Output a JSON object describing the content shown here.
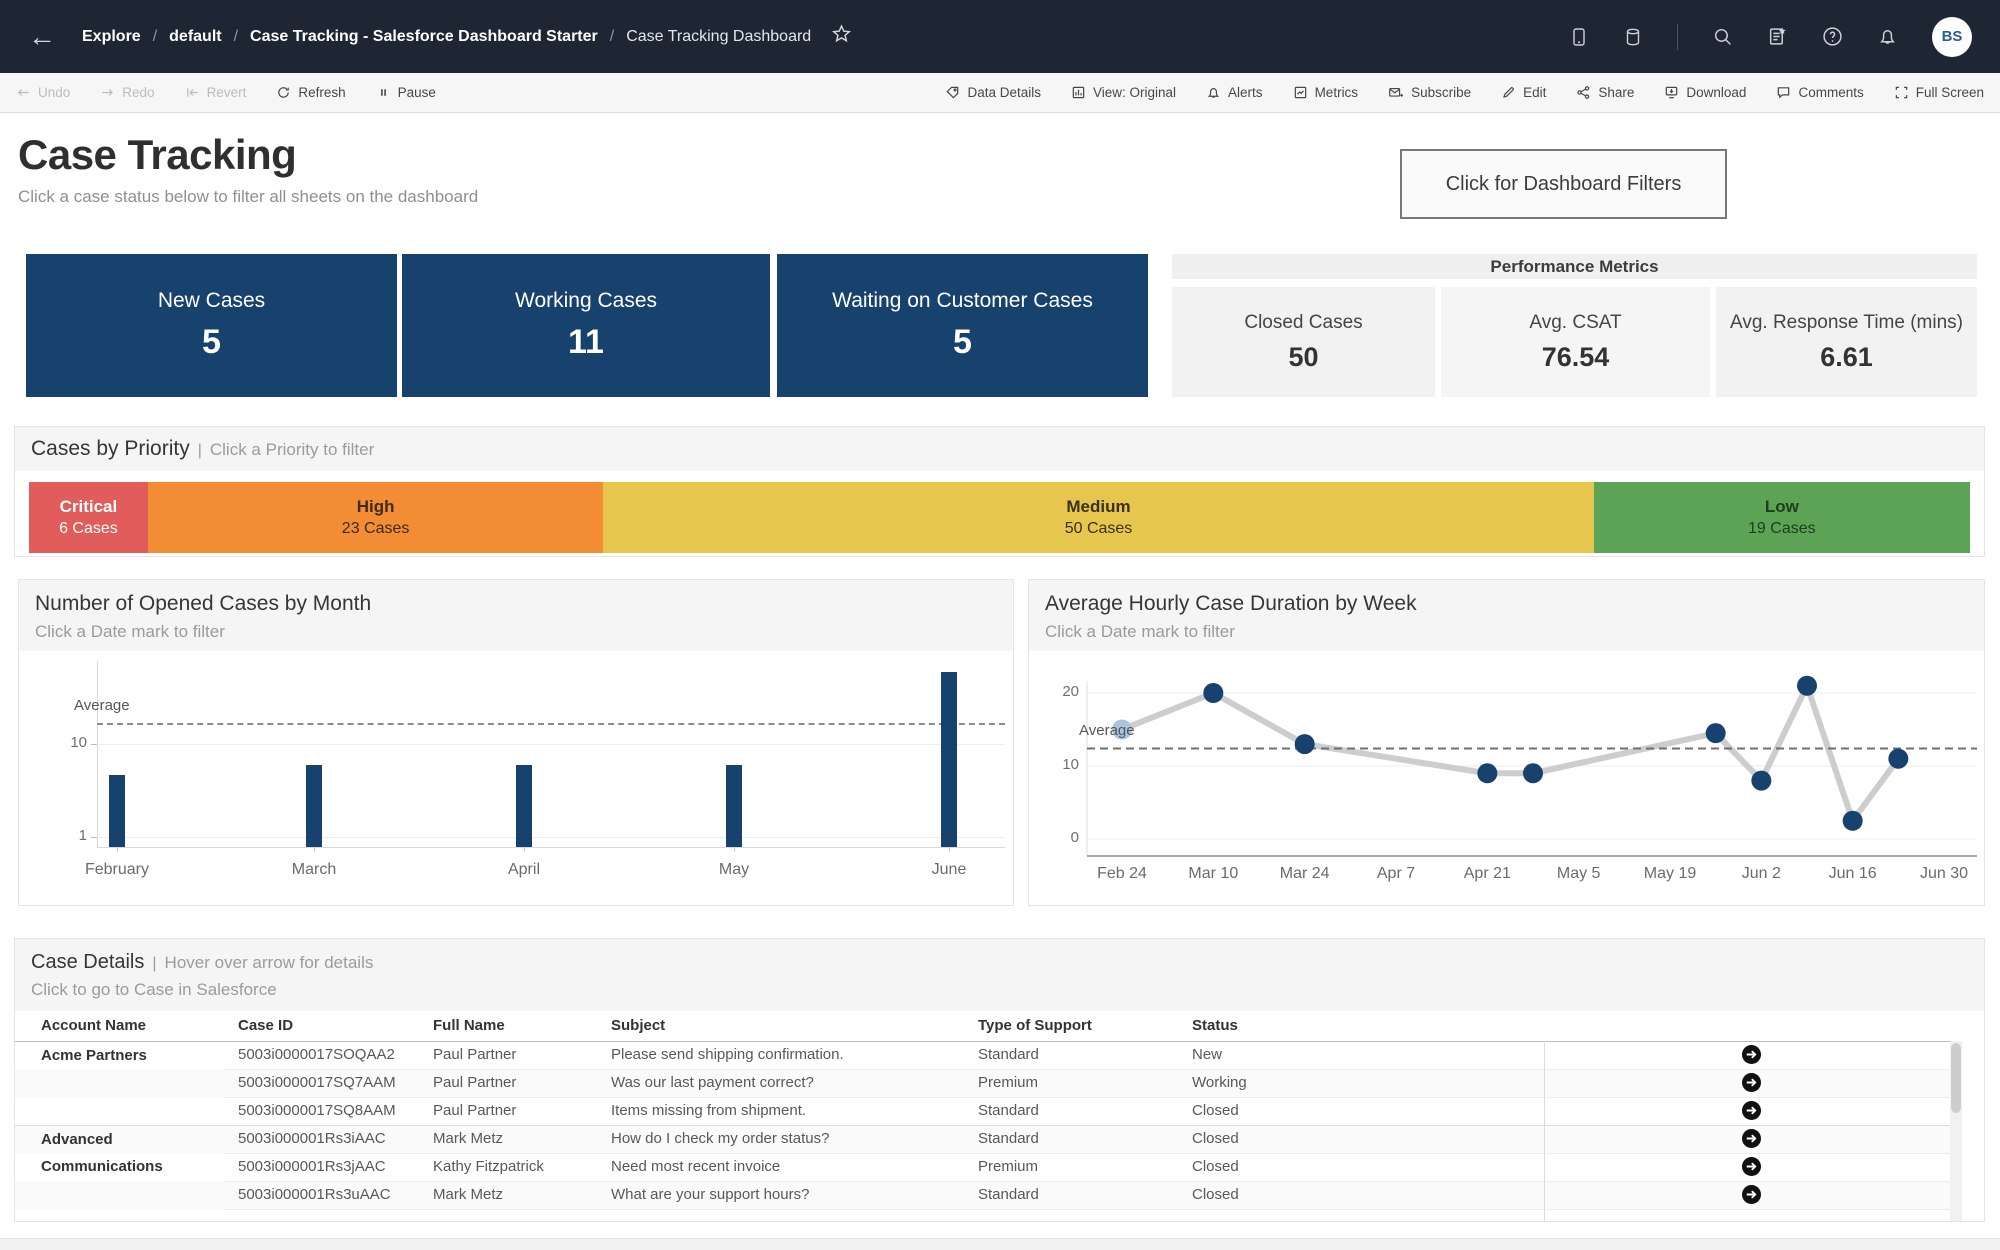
{
  "ui": {
    "pipe": "|"
  },
  "nav": {
    "back_icon": "←",
    "separator": "/",
    "breadcrumb": [
      {
        "label": "Explore"
      },
      {
        "label": "default"
      },
      {
        "label": "Case Tracking - Salesforce Dashboard Starter"
      },
      {
        "label": "Case Tracking Dashboard"
      }
    ],
    "avatar_initials": "BS"
  },
  "toolbar": {
    "left": [
      {
        "label": "Undo",
        "disabled": true
      },
      {
        "label": "Redo",
        "disabled": true
      },
      {
        "label": "Revert",
        "disabled": true
      },
      {
        "label": "Refresh",
        "disabled": false
      },
      {
        "label": "Pause",
        "disabled": false
      }
    ],
    "right": [
      {
        "label": "Data Details"
      },
      {
        "label": "View: Original"
      },
      {
        "label": "Alerts"
      },
      {
        "label": "Metrics"
      },
      {
        "label": "Subscribe"
      },
      {
        "label": "Edit"
      },
      {
        "label": "Share"
      },
      {
        "label": "Download"
      },
      {
        "label": "Comments"
      },
      {
        "label": "Full Screen"
      }
    ]
  },
  "header": {
    "title": "Case Tracking",
    "subtitle": "Click a case status below to filter all sheets on the dashboard",
    "filter_button": "Click for Dashboard Filters"
  },
  "kpis": [
    {
      "label": "New Cases",
      "value": "5",
      "color": "#17426e"
    },
    {
      "label": "Working Cases",
      "value": "11",
      "color": "#17426e"
    },
    {
      "label": "Waiting on Customer Cases",
      "value": "5",
      "color": "#17426e"
    }
  ],
  "performance": {
    "title": "Performance Metrics",
    "metrics": [
      {
        "label": "Closed Cases",
        "value": "50"
      },
      {
        "label": "Avg. CSAT",
        "value": "76.54"
      },
      {
        "label": "Avg. Response Time (mins)",
        "value": "6.61"
      }
    ]
  },
  "priority": {
    "title": "Cases by Priority",
    "hint": "Click a Priority to filter",
    "cases_word": "Cases",
    "segments": [
      {
        "key": "critical",
        "label": "Critical",
        "cases": 6,
        "color": "#e05d5c",
        "text_color": "#ffffff"
      },
      {
        "key": "high",
        "label": "High",
        "cases": 23,
        "color": "#f28d35",
        "text_color": "#3d2c12"
      },
      {
        "key": "medium",
        "label": "Medium",
        "cases": 50,
        "color": "#e7c64e",
        "text_color": "#3a3115"
      },
      {
        "key": "low",
        "label": "Low",
        "cases": 19,
        "color": "#5ca356",
        "text_color": "#1f3d1f"
      }
    ]
  },
  "chart_data": [
    {
      "type": "bar",
      "title": "Number of Opened Cases by Month",
      "subtitle": "Click a Date mark to filter",
      "categories": [
        "February",
        "March",
        "April",
        "May",
        "June"
      ],
      "values": [
        7,
        8,
        8,
        8,
        17
      ],
      "average_line": 12,
      "average_label": "Average",
      "yticks": [
        1,
        10
      ],
      "ylim": [
        0,
        18.5
      ],
      "xlabel": "",
      "ylabel": "",
      "grid": "horizontal-light",
      "legend": "none",
      "bar_color": "#17426e"
    },
    {
      "type": "line",
      "title": "Average Hourly Case Duration by Week",
      "subtitle": "Click a Date mark to filter",
      "x_tick_labels": [
        "Feb 24",
        "Mar 10",
        "Mar 24",
        "Apr 7",
        "Apr 21",
        "May 5",
        "May 19",
        "Jun 2",
        "Jun 16",
        "Jun 30"
      ],
      "points": [
        {
          "week": "Feb 24",
          "week_offset": 0,
          "value": 15,
          "highlighted": true
        },
        {
          "week": "Mar 10",
          "week_offset": 2,
          "value": 20
        },
        {
          "week": "Mar 24",
          "week_offset": 4,
          "value": 13
        },
        {
          "week": "Apr 21",
          "week_offset": 8,
          "value": 9
        },
        {
          "week": "Apr 28",
          "week_offset": 9,
          "value": 9
        },
        {
          "week": "May 26",
          "week_offset": 13,
          "value": 14.5
        },
        {
          "week": "Jun 2",
          "week_offset": 14,
          "value": 8
        },
        {
          "week": "Jun 9",
          "week_offset": 15,
          "value": 21
        },
        {
          "week": "Jun 16",
          "week_offset": 16,
          "value": 2.5
        },
        {
          "week": "Jun 23",
          "week_offset": 17,
          "value": 11
        }
      ],
      "average_line": 12.4,
      "average_label": "Average",
      "yticks": [
        0,
        10,
        20
      ],
      "ylim": [
        -3,
        24
      ],
      "grid": "horizontal-light",
      "legend": "none",
      "line_color": "#cdcdcd",
      "point_color": "#17426e",
      "highlight_point_color": "#a9c4de"
    }
  ],
  "table": {
    "title": "Case Details",
    "title_hint": "Hover over arrow for details",
    "subtitle": "Click to go to Case in Salesforce",
    "columns": [
      "Account Name",
      "Case ID",
      "Full Name",
      "Subject",
      "Type of Support",
      "Status"
    ],
    "rows": [
      {
        "account": "Acme Partners",
        "case_id": "5003i0000017SOQAA2",
        "full_name": "Paul Partner",
        "subject": "Please send shipping confirmation.",
        "support": "Standard",
        "status": "New",
        "group_start": true
      },
      {
        "account": "",
        "case_id": "5003i0000017SQ7AAM",
        "full_name": "Paul Partner",
        "subject": "Was our last payment correct?",
        "support": "Premium",
        "status": "Working",
        "group_start": false
      },
      {
        "account": "",
        "case_id": "5003i0000017SQ8AAM",
        "full_name": "Paul Partner",
        "subject": "Items missing from shipment.",
        "support": "Standard",
        "status": "Closed",
        "group_start": false
      },
      {
        "account": "Advanced Communications",
        "case_id": "5003i000001Rs3iAAC",
        "full_name": "Mark Metz",
        "subject": "How do I check my order status?",
        "support": "Standard",
        "status": "Closed",
        "group_start": true
      },
      {
        "account": "",
        "case_id": "5003i000001Rs3jAAC",
        "full_name": "Kathy Fitzpatrick",
        "subject": "Need most recent invoice",
        "support": "Premium",
        "status": "Closed",
        "group_start": false
      },
      {
        "account": "",
        "case_id": "5003i000001Rs3uAAC",
        "full_name": "Mark Metz",
        "subject": "What are your support hours?",
        "support": "Standard",
        "status": "Closed",
        "group_start": false
      }
    ]
  }
}
